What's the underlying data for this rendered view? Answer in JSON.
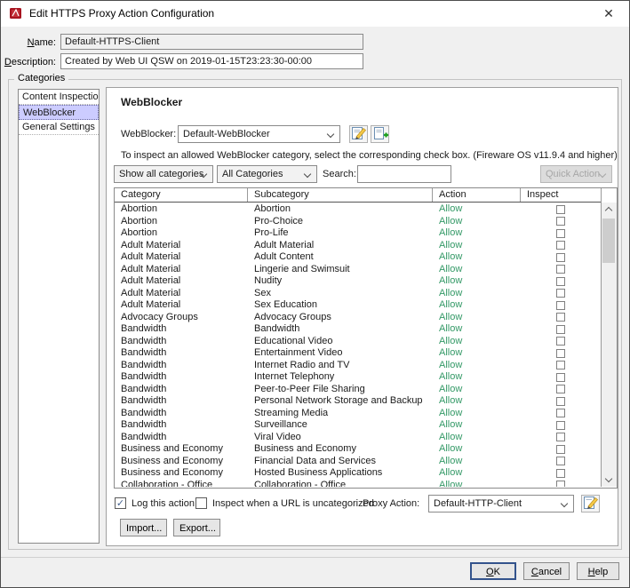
{
  "window": {
    "title": "Edit HTTPS Proxy Action Configuration",
    "close_glyph": "✕"
  },
  "form": {
    "name_label": "Name:",
    "name_value": "Default-HTTPS-Client",
    "description_label": "Description:",
    "description_value": "Created by Web UI QSW on 2019-01-15T23:23:30-00:00"
  },
  "categories_box": {
    "title": "Categories",
    "items": [
      {
        "label": "Content Inspection",
        "selected": false
      },
      {
        "label": "WebBlocker",
        "selected": true
      },
      {
        "label": "General Settings",
        "selected": false
      }
    ]
  },
  "webblocker_panel": {
    "title": "WebBlocker",
    "webblocker_label": "WebBlocker:",
    "webblocker_value": "Default-WebBlocker",
    "instruction": "To inspect an allowed WebBlocker category, select the corresponding check box. (Fireware OS v11.9.4 and higher)",
    "filters": {
      "show_filter": "Show all categories",
      "category_filter": "All Categories",
      "search_label": "Search:",
      "search_value": "",
      "quick_action_label": "Quick Action"
    },
    "table": {
      "headers": [
        "Category",
        "Subcategory",
        "Action",
        "Inspect"
      ],
      "rows": [
        [
          "Abortion",
          "Abortion",
          "Allow",
          false
        ],
        [
          "Abortion",
          "Pro-Choice",
          "Allow",
          false
        ],
        [
          "Abortion",
          "Pro-Life",
          "Allow",
          false
        ],
        [
          "Adult Material",
          "Adult Material",
          "Allow",
          false
        ],
        [
          "Adult Material",
          "Adult Content",
          "Allow",
          false
        ],
        [
          "Adult Material",
          "Lingerie and Swimsuit",
          "Allow",
          false
        ],
        [
          "Adult Material",
          "Nudity",
          "Allow",
          false
        ],
        [
          "Adult Material",
          "Sex",
          "Allow",
          false
        ],
        [
          "Adult Material",
          "Sex Education",
          "Allow",
          false
        ],
        [
          "Advocacy Groups",
          "Advocacy Groups",
          "Allow",
          false
        ],
        [
          "Bandwidth",
          "Bandwidth",
          "Allow",
          false
        ],
        [
          "Bandwidth",
          "Educational Video",
          "Allow",
          false
        ],
        [
          "Bandwidth",
          "Entertainment Video",
          "Allow",
          false
        ],
        [
          "Bandwidth",
          "Internet Radio and TV",
          "Allow",
          false
        ],
        [
          "Bandwidth",
          "Internet Telephony",
          "Allow",
          false
        ],
        [
          "Bandwidth",
          "Peer-to-Peer File Sharing",
          "Allow",
          false
        ],
        [
          "Bandwidth",
          "Personal Network Storage and Backup",
          "Allow",
          false
        ],
        [
          "Bandwidth",
          "Streaming Media",
          "Allow",
          false
        ],
        [
          "Bandwidth",
          "Surveillance",
          "Allow",
          false
        ],
        [
          "Bandwidth",
          "Viral Video",
          "Allow",
          false
        ],
        [
          "Business and Economy",
          "Business and Economy",
          "Allow",
          false
        ],
        [
          "Business and Economy",
          "Financial Data and Services",
          "Allow",
          false
        ],
        [
          "Business and Economy",
          "Hosted Business Applications",
          "Allow",
          false
        ],
        [
          "Collaboration - Office",
          "Collaboration - Office",
          "Allow",
          false
        ]
      ]
    },
    "footer": {
      "log_label": "Log this action",
      "log_checked": true,
      "uncategorized_label": "Inspect when a URL is uncategorized",
      "uncategorized_checked": false,
      "proxy_action_label": "Proxy Action:",
      "proxy_action_value": "Default-HTTP-Client",
      "import_label": "Import...",
      "export_label": "Export..."
    }
  },
  "dialog_buttons": {
    "ok": "OK",
    "cancel": "Cancel",
    "help": "Help"
  },
  "colors": {
    "allow_green": "#339966",
    "selection": "#ccccff"
  },
  "glyphs": {
    "check": "✓"
  }
}
